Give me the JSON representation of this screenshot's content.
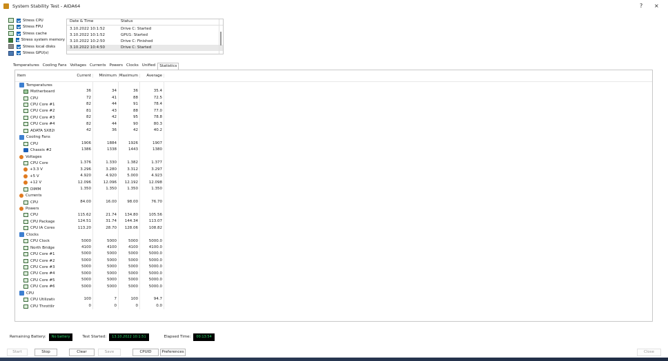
{
  "window": {
    "title": "System Stability Test - AIDA64",
    "help_glyph": "?",
    "close_glyph": "×"
  },
  "devices": [
    {
      "label": "Stress CPU",
      "icon": "cpu-chip-icon"
    },
    {
      "label": "Stress FPU",
      "icon": "fpu-chip-icon"
    },
    {
      "label": "Stress cache",
      "icon": "cache-chip-icon"
    },
    {
      "label": "Stress system memory",
      "icon": "memory-module-icon"
    },
    {
      "label": "Stress local disks",
      "icon": "hard-disk-icon"
    },
    {
      "label": "Stress GPU(s)",
      "icon": "gpu-card-icon"
    }
  ],
  "log": {
    "headers": [
      "Date & Time",
      "Status"
    ],
    "rows": [
      [
        "3.10.2022 10:1:52",
        "Drive C: Started"
      ],
      [
        "3.10.2022 10:1:52",
        "GPU1: Started"
      ],
      [
        "3.10.2022 10:2:50",
        "Drive C: Finished"
      ],
      [
        "3.10.2022 10:4:50",
        "Drive C: Started"
      ]
    ]
  },
  "tabs": [
    "Temperatures",
    "Cooling Fans",
    "Voltages",
    "Currents",
    "Powers",
    "Clocks",
    "Unified",
    "Statistics"
  ],
  "active_tab": "Statistics",
  "grid": {
    "headers": {
      "item": "Item",
      "current": "Current",
      "minimum": "Minimum",
      "maximum": "Maximum",
      "average": "Average"
    },
    "rows": [
      {
        "type": "group",
        "name": "Temperatures",
        "icon": "thermometer-icon"
      },
      {
        "type": "item",
        "name": "Motherboard",
        "cur": "36",
        "min": "34",
        "max": "36",
        "avg": "35.4",
        "icon": "motherboard-icon"
      },
      {
        "type": "item",
        "name": "CPU",
        "cur": "72",
        "min": "41",
        "max": "88",
        "avg": "72.5",
        "icon": "cpu-icon"
      },
      {
        "type": "item",
        "name": "CPU Core #1",
        "cur": "82",
        "min": "44",
        "max": "91",
        "avg": "78.4",
        "icon": "cpu-icon"
      },
      {
        "type": "item",
        "name": "CPU Core #2",
        "cur": "81",
        "min": "43",
        "max": "88",
        "avg": "77.0",
        "icon": "cpu-icon"
      },
      {
        "type": "item",
        "name": "CPU Core #3",
        "cur": "82",
        "min": "42",
        "max": "95",
        "avg": "78.8",
        "icon": "cpu-icon"
      },
      {
        "type": "item",
        "name": "CPU Core #4",
        "cur": "82",
        "min": "44",
        "max": "90",
        "avg": "80.3",
        "icon": "cpu-icon"
      },
      {
        "type": "item",
        "name": "ADATA SX8200PNP",
        "cur": "42",
        "min": "36",
        "max": "42",
        "avg": "40.2",
        "icon": "ssd-icon"
      },
      {
        "type": "group",
        "name": "Cooling Fans",
        "icon": "fan-icon"
      },
      {
        "type": "item",
        "name": "CPU",
        "cur": "1906",
        "min": "1884",
        "max": "1926",
        "avg": "1907",
        "icon": "cpu-icon"
      },
      {
        "type": "item",
        "name": "Chassis #2",
        "cur": "1386",
        "min": "1338",
        "max": "1443",
        "avg": "1380",
        "icon": "chassis-fan-icon"
      },
      {
        "type": "group",
        "name": "Voltages",
        "icon": "voltage-icon"
      },
      {
        "type": "item",
        "name": "CPU Core",
        "cur": "1.376",
        "min": "1.330",
        "max": "1.382",
        "avg": "1.377",
        "icon": "cpu-icon"
      },
      {
        "type": "item",
        "name": "+3.3 V",
        "cur": "3.296",
        "min": "3.280",
        "max": "3.312",
        "avg": "3.297",
        "icon": "voltage-icon"
      },
      {
        "type": "item",
        "name": "+5 V",
        "cur": "4.920",
        "min": "4.920",
        "max": "5.000",
        "avg": "4.923",
        "icon": "voltage-icon"
      },
      {
        "type": "item",
        "name": "+12 V",
        "cur": "12.096",
        "min": "12.096",
        "max": "12.192",
        "avg": "12.098",
        "icon": "voltage-icon"
      },
      {
        "type": "item",
        "name": "DIMM",
        "cur": "1.350",
        "min": "1.350",
        "max": "1.350",
        "avg": "1.350",
        "icon": "memory-module-icon"
      },
      {
        "type": "group",
        "name": "Currents",
        "icon": "current-icon"
      },
      {
        "type": "item",
        "name": "CPU",
        "cur": "84.00",
        "min": "16.00",
        "max": "98.00",
        "avg": "76.70",
        "icon": "cpu-icon"
      },
      {
        "type": "group",
        "name": "Powers",
        "icon": "power-icon"
      },
      {
        "type": "item",
        "name": "CPU",
        "cur": "115.62",
        "min": "21.74",
        "max": "134.80",
        "avg": "105.56",
        "icon": "cpu-icon"
      },
      {
        "type": "item",
        "name": "CPU Package",
        "cur": "124.51",
        "min": "31.74",
        "max": "144.34",
        "avg": "113.07",
        "icon": "cpu-icon"
      },
      {
        "type": "item",
        "name": "CPU IA Cores",
        "cur": "113.20",
        "min": "28.70",
        "max": "128.06",
        "avg": "108.82",
        "icon": "cpu-icon"
      },
      {
        "type": "group",
        "name": "Clocks",
        "icon": "clock-icon"
      },
      {
        "type": "item",
        "name": "CPU Clock",
        "cur": "5000",
        "min": "5000",
        "max": "5000",
        "avg": "5000.0",
        "icon": "cpu-icon"
      },
      {
        "type": "item",
        "name": "North Bridge Clock",
        "cur": "4100",
        "min": "4100",
        "max": "4100",
        "avg": "4100.0",
        "icon": "northbridge-icon"
      },
      {
        "type": "item",
        "name": "CPU Core #1 Clock",
        "cur": "5000",
        "min": "5000",
        "max": "5000",
        "avg": "5000.0",
        "icon": "cpu-icon"
      },
      {
        "type": "item",
        "name": "CPU Core #2 Clock",
        "cur": "5000",
        "min": "5000",
        "max": "5000",
        "avg": "5000.0",
        "icon": "cpu-icon"
      },
      {
        "type": "item",
        "name": "CPU Core #3 Clock",
        "cur": "5000",
        "min": "5000",
        "max": "5000",
        "avg": "5000.0",
        "icon": "cpu-icon"
      },
      {
        "type": "item",
        "name": "CPU Core #4 Clock",
        "cur": "5000",
        "min": "5000",
        "max": "5000",
        "avg": "5000.0",
        "icon": "cpu-icon"
      },
      {
        "type": "item",
        "name": "CPU Core #5 Clock",
        "cur": "5000",
        "min": "5000",
        "max": "5000",
        "avg": "5000.0",
        "icon": "cpu-icon"
      },
      {
        "type": "item",
        "name": "CPU Core #6 Clock",
        "cur": "5000",
        "min": "5000",
        "max": "5000",
        "avg": "5000.0",
        "icon": "cpu-icon"
      },
      {
        "type": "group",
        "name": "CPU",
        "icon": "cpu-icon"
      },
      {
        "type": "item",
        "name": "CPU Utilization",
        "cur": "100",
        "min": "7",
        "max": "100",
        "avg": "94.7",
        "icon": "utilization-icon"
      },
      {
        "type": "item",
        "name": "CPU Throttling",
        "cur": "0",
        "min": "0",
        "max": "0",
        "avg": "0.0",
        "icon": "cpu-icon"
      }
    ]
  },
  "status": {
    "battery_label": "Remaining Battery:",
    "battery_value": "No battery",
    "started_label": "Test Started:",
    "started_value": "13.10.2022 10:1:51",
    "elapsed_label": "Elapsed Time:",
    "elapsed_value": "00:13:54"
  },
  "buttons": {
    "start": "Start",
    "stop": "Stop",
    "clear": "Clear",
    "save": "Save",
    "cpuid": "CPUID",
    "preferences": "Preferences",
    "close": "Close"
  },
  "colors": {
    "accent": "#1a73c9",
    "status_text": "#2bd66a"
  }
}
